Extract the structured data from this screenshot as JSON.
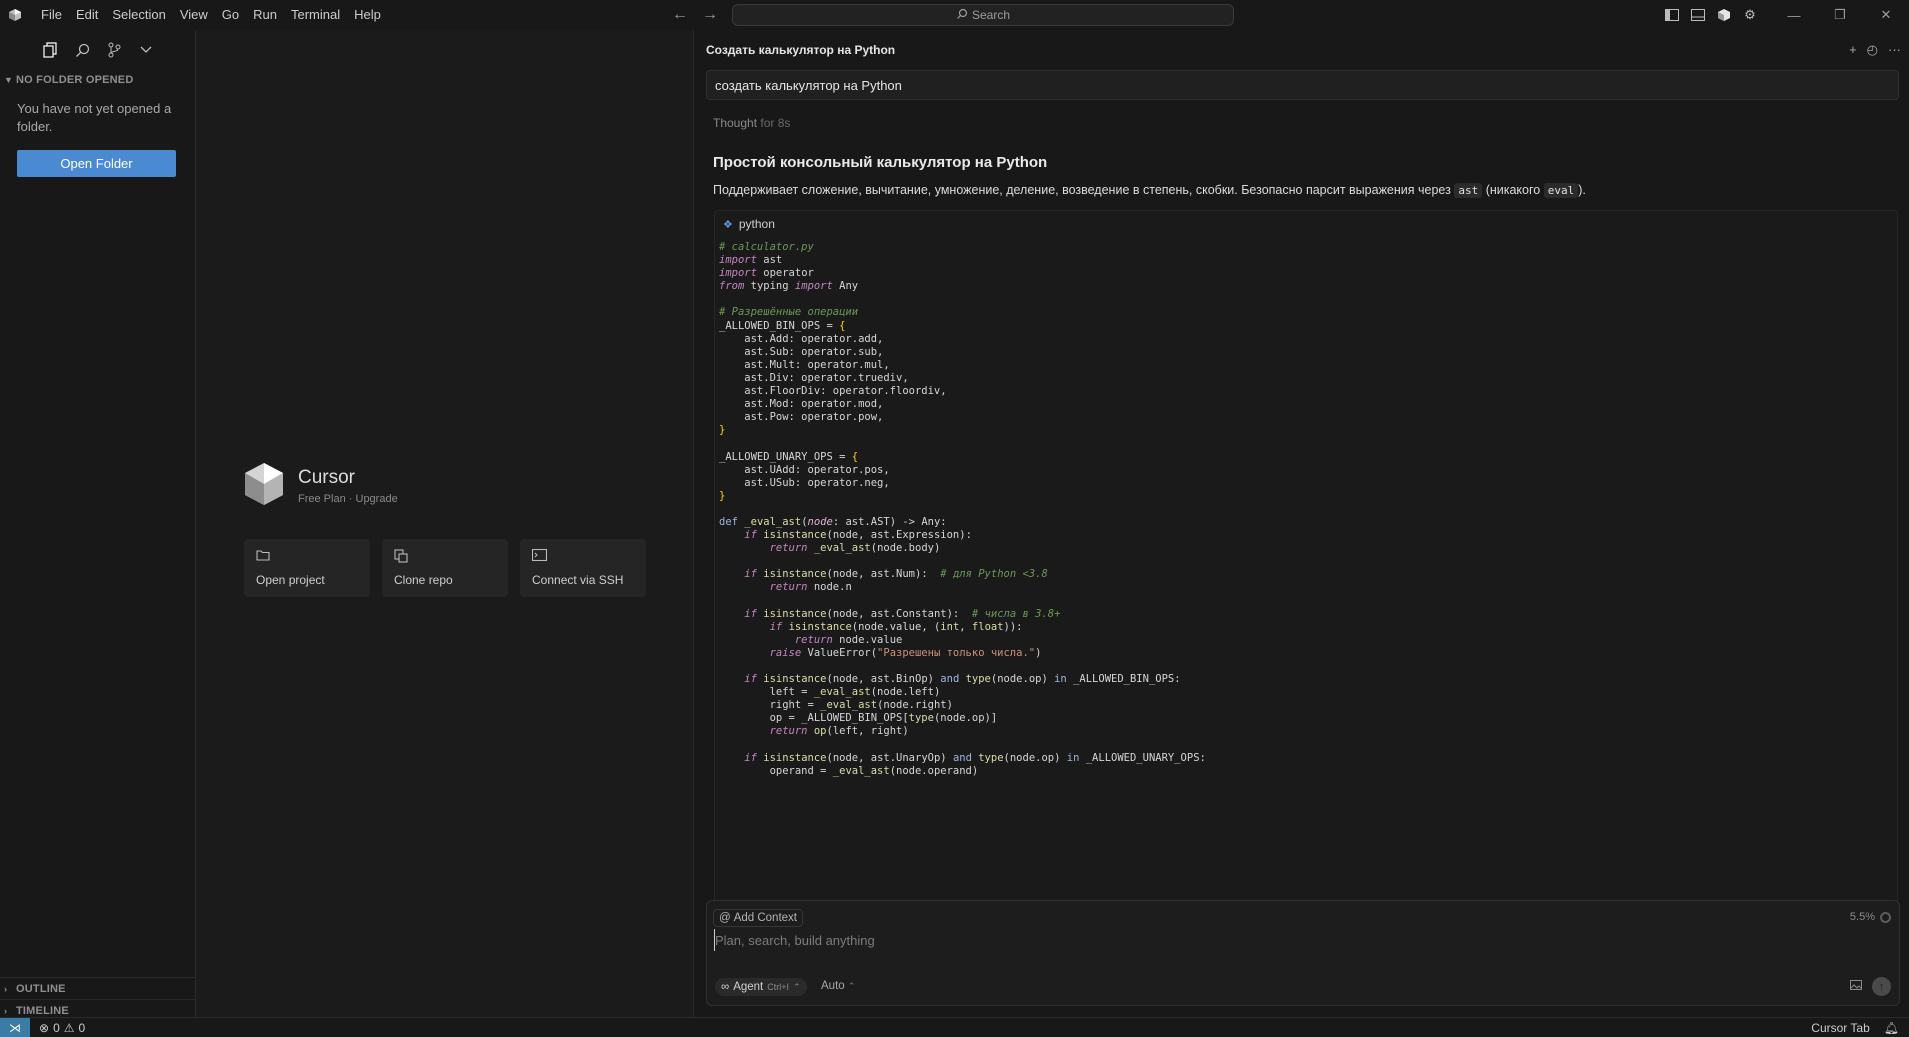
{
  "menu": [
    "File",
    "Edit",
    "Selection",
    "View",
    "Go",
    "Run",
    "Terminal",
    "Help"
  ],
  "search": {
    "label": "Search"
  },
  "sidebar": {
    "section_title": "NO FOLDER OPENED",
    "message": "You have not yet opened a folder.",
    "open_folder": "Open Folder",
    "outline": "OUTLINE",
    "timeline": "TIMELINE"
  },
  "welcome": {
    "brand": "Cursor",
    "plan": "Free Plan",
    "separator": "·",
    "upgrade": "Upgrade",
    "cards": [
      "Open project",
      "Clone repo",
      "Connect via SSH"
    ]
  },
  "chat": {
    "tab_title": "Создать калькулятор на Python",
    "user_message": "создать калькулятор на Python",
    "thought_label": "Thought",
    "thought_time": "for 8s",
    "answer_title": "Простой консольный калькулятор на Python",
    "answer_desc_1": "Поддерживает сложение, вычитание, умножение, деление, возведение в степень, скобки. Безопасно парсит выражения через",
    "answer_code_1": "ast",
    "answer_desc_2": "(никакого",
    "answer_code_2": "eval",
    "answer_desc_3": ").",
    "code_lang": "python"
  },
  "code_lines": [
    [
      {
        "t": "# calculator.py",
        "c": "cm"
      }
    ],
    [
      {
        "t": "import",
        "c": "kw"
      },
      {
        "t": " ast",
        "c": "tx"
      }
    ],
    [
      {
        "t": "import",
        "c": "kw"
      },
      {
        "t": " operator",
        "c": "tx"
      }
    ],
    [
      {
        "t": "from",
        "c": "kw"
      },
      {
        "t": " typing ",
        "c": "tx"
      },
      {
        "t": "import",
        "c": "kw"
      },
      {
        "t": " Any",
        "c": "tx"
      }
    ],
    [],
    [
      {
        "t": "# Разрешённые операции",
        "c": "cm"
      }
    ],
    [
      {
        "t": "_ALLOWED_BIN_OPS = ",
        "c": "tx"
      },
      {
        "t": "{",
        "c": "br"
      }
    ],
    [
      {
        "t": "    ast.Add: operator.add,",
        "c": "tx"
      }
    ],
    [
      {
        "t": "    ast.Sub: operator.sub,",
        "c": "tx"
      }
    ],
    [
      {
        "t": "    ast.Mult: operator.mul,",
        "c": "tx"
      }
    ],
    [
      {
        "t": "    ast.Div: operator.truediv,",
        "c": "tx"
      }
    ],
    [
      {
        "t": "    ast.FloorDiv: operator.floordiv,",
        "c": "tx"
      }
    ],
    [
      {
        "t": "    ast.Mod: operator.mod,",
        "c": "tx"
      }
    ],
    [
      {
        "t": "    ast.Pow: operator.pow,",
        "c": "tx"
      }
    ],
    [
      {
        "t": "}",
        "c": "br"
      }
    ],
    [],
    [
      {
        "t": "_ALLOWED_UNARY_OPS = ",
        "c": "tx"
      },
      {
        "t": "{",
        "c": "br"
      }
    ],
    [
      {
        "t": "    ast.UAdd: operator.pos,",
        "c": "tx"
      }
    ],
    [
      {
        "t": "    ast.USub: operator.neg,",
        "c": "tx"
      }
    ],
    [
      {
        "t": "}",
        "c": "br"
      }
    ],
    [],
    [
      {
        "t": "def ",
        "c": "kd"
      },
      {
        "t": "_eval_ast",
        "c": "fn"
      },
      {
        "t": "(",
        "c": "tx"
      },
      {
        "t": "node",
        "c": "pm"
      },
      {
        "t": ": ast.AST) -> Any:",
        "c": "tx"
      }
    ],
    [
      {
        "t": "    ",
        "c": "tx"
      },
      {
        "t": "if",
        "c": "kw"
      },
      {
        "t": " ",
        "c": "tx"
      },
      {
        "t": "isinstance",
        "c": "fn"
      },
      {
        "t": "(node, ast.Expression):",
        "c": "tx"
      }
    ],
    [
      {
        "t": "        ",
        "c": "tx"
      },
      {
        "t": "return",
        "c": "kw"
      },
      {
        "t": " ",
        "c": "tx"
      },
      {
        "t": "_eval_ast",
        "c": "fn"
      },
      {
        "t": "(node.body)",
        "c": "tx"
      }
    ],
    [],
    [
      {
        "t": "    ",
        "c": "tx"
      },
      {
        "t": "if",
        "c": "kw"
      },
      {
        "t": " ",
        "c": "tx"
      },
      {
        "t": "isinstance",
        "c": "fn"
      },
      {
        "t": "(node, ast.Num):  ",
        "c": "tx"
      },
      {
        "t": "# для Python <3.8",
        "c": "cm"
      }
    ],
    [
      {
        "t": "        ",
        "c": "tx"
      },
      {
        "t": "return",
        "c": "kw"
      },
      {
        "t": " node.n",
        "c": "tx"
      }
    ],
    [],
    [
      {
        "t": "    ",
        "c": "tx"
      },
      {
        "t": "if",
        "c": "kw"
      },
      {
        "t": " ",
        "c": "tx"
      },
      {
        "t": "isinstance",
        "c": "fn"
      },
      {
        "t": "(node, ast.Constant):  ",
        "c": "tx"
      },
      {
        "t": "# числа в 3.8+",
        "c": "cm"
      }
    ],
    [
      {
        "t": "        ",
        "c": "tx"
      },
      {
        "t": "if",
        "c": "kw"
      },
      {
        "t": " ",
        "c": "tx"
      },
      {
        "t": "isinstance",
        "c": "fn"
      },
      {
        "t": "(node.value, (",
        "c": "tx"
      },
      {
        "t": "int",
        "c": "fn"
      },
      {
        "t": ", ",
        "c": "tx"
      },
      {
        "t": "float",
        "c": "fn"
      },
      {
        "t": ")):",
        "c": "tx"
      }
    ],
    [
      {
        "t": "            ",
        "c": "tx"
      },
      {
        "t": "return",
        "c": "kw"
      },
      {
        "t": " node.value",
        "c": "tx"
      }
    ],
    [
      {
        "t": "        ",
        "c": "tx"
      },
      {
        "t": "raise",
        "c": "kw"
      },
      {
        "t": " ValueError(",
        "c": "tx"
      },
      {
        "t": "\"Разрешены только числа.\"",
        "c": "st"
      },
      {
        "t": ")",
        "c": "tx"
      }
    ],
    [],
    [
      {
        "t": "    ",
        "c": "tx"
      },
      {
        "t": "if",
        "c": "kw"
      },
      {
        "t": " ",
        "c": "tx"
      },
      {
        "t": "isinstance",
        "c": "fn"
      },
      {
        "t": "(node, ast.BinOp) ",
        "c": "tx"
      },
      {
        "t": "and",
        "c": "kd"
      },
      {
        "t": " ",
        "c": "tx"
      },
      {
        "t": "type",
        "c": "fn"
      },
      {
        "t": "(node.op) ",
        "c": "tx"
      },
      {
        "t": "in",
        "c": "kd"
      },
      {
        "t": " _ALLOWED_BIN_OPS:",
        "c": "tx"
      }
    ],
    [
      {
        "t": "        left = ",
        "c": "tx"
      },
      {
        "t": "_eval_ast",
        "c": "fn"
      },
      {
        "t": "(node.left)",
        "c": "tx"
      }
    ],
    [
      {
        "t": "        right = ",
        "c": "tx"
      },
      {
        "t": "_eval_ast",
        "c": "fn"
      },
      {
        "t": "(node.right)",
        "c": "tx"
      }
    ],
    [
      {
        "t": "        op = _ALLOWED_BIN_OPS[",
        "c": "tx"
      },
      {
        "t": "type",
        "c": "fn"
      },
      {
        "t": "(node.op)]",
        "c": "tx"
      }
    ],
    [
      {
        "t": "        ",
        "c": "tx"
      },
      {
        "t": "return",
        "c": "kw"
      },
      {
        "t": " ",
        "c": "tx"
      },
      {
        "t": "op",
        "c": "fn"
      },
      {
        "t": "(left, right)",
        "c": "tx"
      }
    ],
    [],
    [
      {
        "t": "    ",
        "c": "tx"
      },
      {
        "t": "if",
        "c": "kw"
      },
      {
        "t": " ",
        "c": "tx"
      },
      {
        "t": "isinstance",
        "c": "fn"
      },
      {
        "t": "(node, ast.UnaryOp) ",
        "c": "tx"
      },
      {
        "t": "and",
        "c": "kd"
      },
      {
        "t": " ",
        "c": "tx"
      },
      {
        "t": "type",
        "c": "fn"
      },
      {
        "t": "(node.op) ",
        "c": "tx"
      },
      {
        "t": "in",
        "c": "kd"
      },
      {
        "t": " _ALLOWED_UNARY_OPS:",
        "c": "tx"
      }
    ],
    [
      {
        "t": "        operand = ",
        "c": "tx"
      },
      {
        "t": "_eval_ast",
        "c": "fn"
      },
      {
        "t": "(node.operand)",
        "c": "tx"
      }
    ]
  ],
  "syntax_colors": {
    "cm": "#6a9955",
    "kw": "#c586c0",
    "kd": "#9fb4de",
    "fn": "#dcdcaa",
    "tx": "#d6d6d6",
    "br": "#ffd700",
    "pm": "#e0b0d8",
    "st": "#ce9178"
  },
  "composer": {
    "add_context": "Add Context",
    "context_usage": "5.5%",
    "placeholder": "Plan, search, build anything",
    "agent": "Agent",
    "agent_shortcut": "Ctrl+I",
    "model": "Auto"
  },
  "status": {
    "errors": "0",
    "warnings": "0",
    "cursor_tab": "Cursor Tab"
  },
  "colors": {
    "accent": "#4a8ad3",
    "remote": "#3a7ca5"
  }
}
